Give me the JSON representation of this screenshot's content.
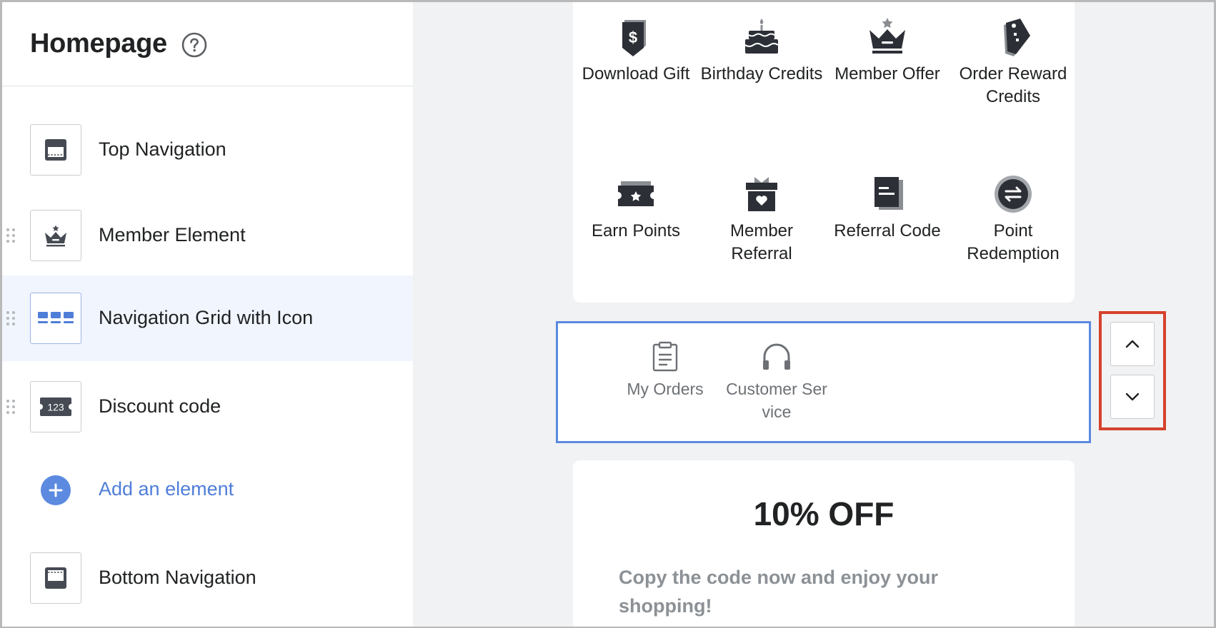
{
  "sidebar": {
    "title": "Homepage",
    "help_icon": "question-circle-icon",
    "elements": [
      {
        "label": "Top Navigation",
        "icon": "top-navigation-icon",
        "draggable": false,
        "selected": false
      },
      {
        "label": "Member Element",
        "icon": "crown-icon",
        "draggable": true,
        "selected": false
      },
      {
        "label": "Navigation Grid with Icon",
        "icon": "grid-icon",
        "draggable": true,
        "selected": true
      },
      {
        "label": "Discount code",
        "icon": "ticket-123-icon",
        "draggable": true,
        "selected": false
      }
    ],
    "add_element_label": "Add an element",
    "bottom_element": {
      "label": "Bottom Navigation",
      "icon": "bottom-navigation-icon"
    }
  },
  "preview": {
    "grid_items": [
      {
        "label": "Download Gift",
        "icon": "dollar-tag-icon"
      },
      {
        "label": "Birthday Credits",
        "icon": "cake-icon"
      },
      {
        "label": "Member Offer",
        "icon": "crown-icon"
      },
      {
        "label": "Order Reward Credits",
        "icon": "price-tag-icon"
      },
      {
        "label": "Earn Points",
        "icon": "star-ticket-icon"
      },
      {
        "label": "Member Referral",
        "icon": "gift-heart-icon"
      },
      {
        "label": "Referral Code",
        "icon": "document-icon"
      },
      {
        "label": "Point Redemption",
        "icon": "exchange-icon"
      }
    ],
    "selected_block": {
      "items": [
        {
          "label": "My Orders",
          "icon": "clipboard-icon"
        },
        {
          "label": "Customer Ser vice",
          "icon": "headphones-icon"
        }
      ]
    },
    "move_controls": {
      "up_icon": "chevron-up-icon",
      "down_icon": "chevron-down-icon"
    },
    "discount": {
      "title": "10% OFF",
      "text": "Copy the code now and enjoy your shopping!"
    }
  },
  "colors": {
    "accent": "#5b8ae0",
    "highlight_border": "#d6422c",
    "canvas_background": "#f1f2f3",
    "selected_row": "#f1f5fd",
    "icon_dark": "#2c2f36"
  }
}
